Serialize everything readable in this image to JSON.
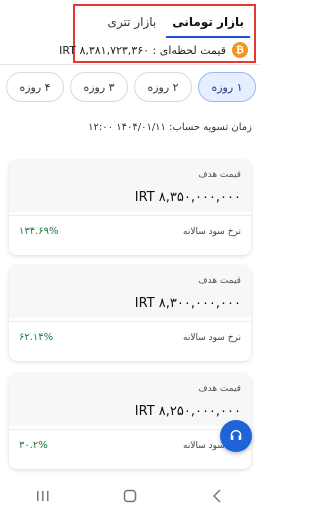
{
  "tabs": [
    {
      "label": "بازار تومانی",
      "active": true
    },
    {
      "label": "بازار تتری",
      "active": false
    }
  ],
  "price": {
    "text": "قیمت لحظه‌ای : IRT ۸,۳۸۱,۷۲۳,۳۶۰",
    "icon": "bitcoin-icon"
  },
  "periods": [
    {
      "label": "۱ روزه",
      "active": true
    },
    {
      "label": "۲ روزه",
      "active": false
    },
    {
      "label": "۳ روزه",
      "active": false
    },
    {
      "label": "۴ روزه",
      "active": false
    }
  ],
  "settlement": "زمان تسویه حساب: ۱۴۰۴/۰۱/۱۱ ۱۲:۰۰",
  "cards": [
    {
      "label": "قیمت هدف",
      "amount": "IRT ۸,۳۵۰,۰۰۰,۰۰۰",
      "rate_label": "نرخ سود سالانه",
      "rate": "۱۳۴.۶۹%"
    },
    {
      "label": "قیمت هدف",
      "amount": "IRT ۸,۳۰۰,۰۰۰,۰۰۰",
      "rate_label": "نرخ سود سالانه",
      "rate": "۶۲.۱۴%"
    },
    {
      "label": "قیمت هدف",
      "amount": "IRT ۸,۲۵۰,۰۰۰,۰۰۰",
      "rate_label": "نرخ سود سالانه",
      "rate": "۳۰.۲%"
    }
  ],
  "colors": {
    "accent": "#1e63d8",
    "highlight_border": "#e53935",
    "bitcoin": "#f7931a",
    "profit": "#1b7a3a"
  },
  "nav": [
    "recent-apps-icon",
    "home-icon",
    "back-icon"
  ],
  "fab_icon": "headset-icon"
}
